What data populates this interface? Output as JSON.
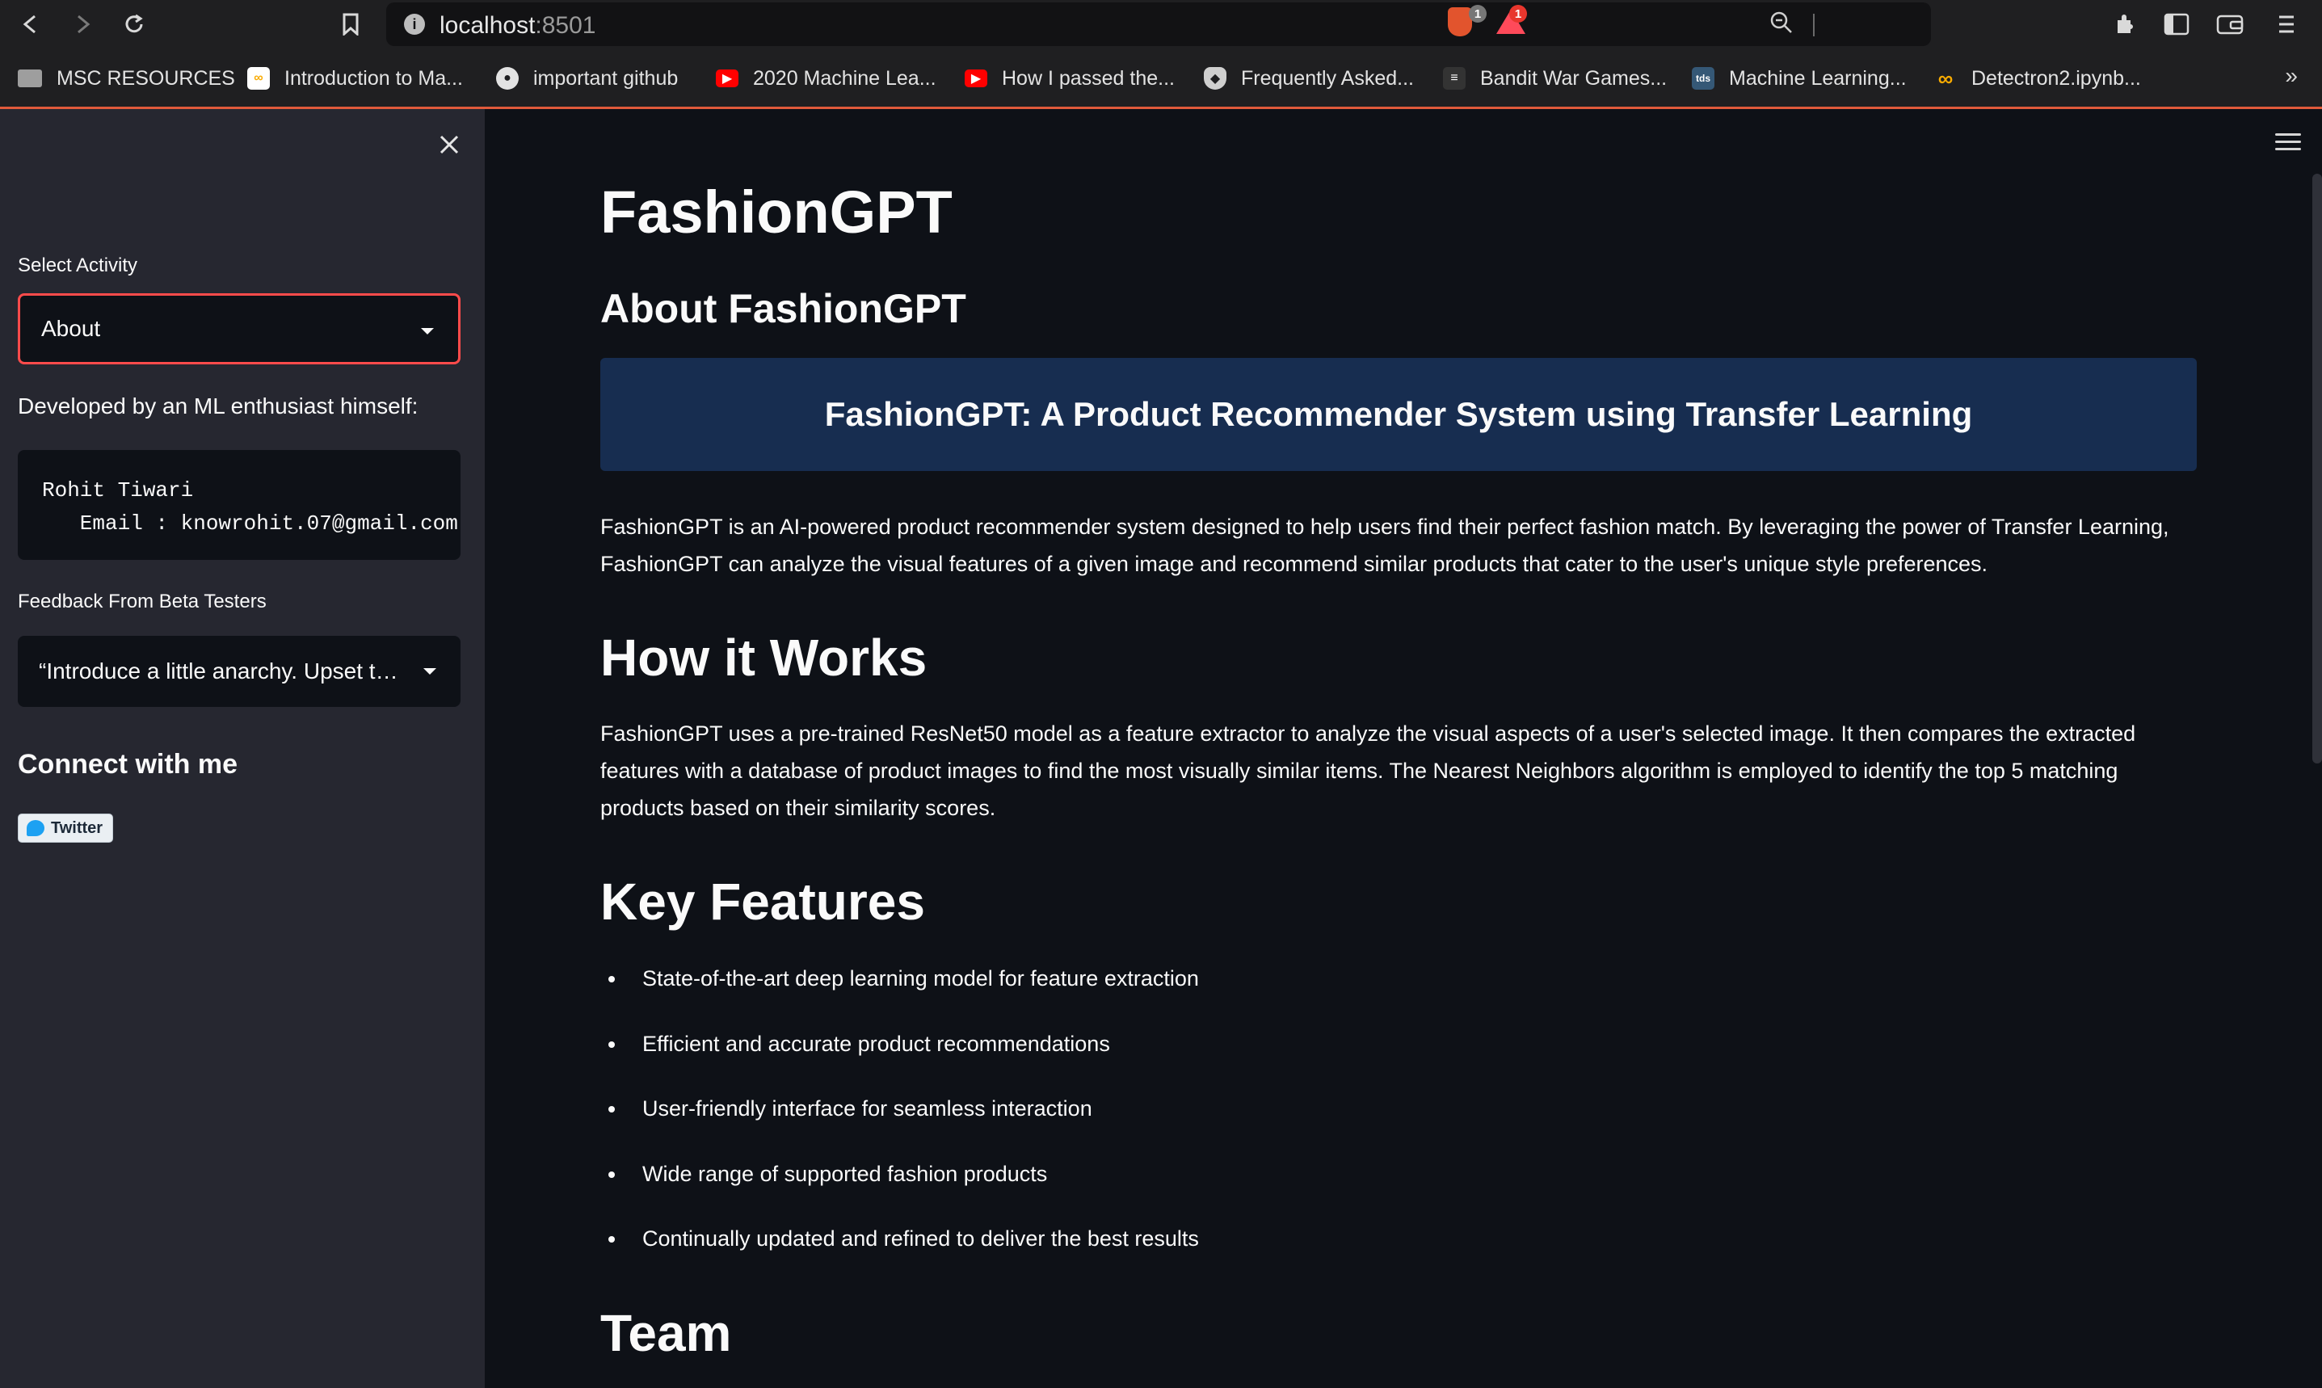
{
  "browser": {
    "url_host": "localhost",
    "url_port": ":8501",
    "shield_badge": "1",
    "rewards_badge": "1",
    "bookmarks": [
      {
        "label": "MSC RESOURCES",
        "icon": "folder-icon",
        "color": "#9e9e9e"
      },
      {
        "label": "Introduction to Ma...",
        "icon": "colab-icon",
        "color": "#ffffff"
      },
      {
        "label": "important github",
        "icon": "github-icon",
        "color": "#e3e3e3"
      },
      {
        "label": "2020 Machine Lea...",
        "icon": "youtube-icon",
        "color": "#ff0000"
      },
      {
        "label": "How I passed the...",
        "icon": "youtube-icon",
        "color": "#ff0000"
      },
      {
        "label": "Frequently Asked...",
        "icon": "shield-icon",
        "color": "#cfcfcf"
      },
      {
        "label": "Bandit War Games...",
        "icon": "overthewire-icon",
        "color": "#333333"
      },
      {
        "label": "Machine Learning...",
        "icon": "tds-icon",
        "color": "#355876"
      },
      {
        "label": "Detectron2.ipynb...",
        "icon": "colab-icon",
        "color": "#f9ab00"
      }
    ],
    "more": "»"
  },
  "sidebar": {
    "select_activity_label": "Select Activity",
    "select_activity_value": "About",
    "developer_label": "Developed by an ML enthusiast himself:",
    "developer_code": "Rohit Tiwari\n   Email : knowrohit.07@gmail.com",
    "feedback_label": "Feedback From Beta Testers",
    "feedback_value": "“Introduce a little anarchy. Upset the established order, and everything becomes chaos.”",
    "connect_title": "Connect with me",
    "twitter_label": "Twitter"
  },
  "main": {
    "title": "FashionGPT",
    "about_heading": "About FashionGPT",
    "banner": "FashionGPT: A Product Recommender System using Transfer Learning",
    "intro": "FashionGPT is an AI-powered product recommender system designed to help users find their perfect fashion match. By leveraging the power of Transfer Learning, FashionGPT can analyze the visual features of a given image and recommend similar products that cater to the user's unique style preferences.",
    "how_heading": "How it Works",
    "how_text": "FashionGPT uses a pre-trained ResNet50 model as a feature extractor to analyze the visual aspects of a user's selected image. It then compares the extracted features with a database of product images to find the most visually similar items. The Nearest Neighbors algorithm is employed to identify the top 5 matching products based on their similarity scores.",
    "key_heading": "Key Features",
    "features": [
      "State-of-the-art deep learning model for feature extraction",
      "Efficient and accurate product recommendations",
      "User-friendly interface for seamless interaction",
      "Wide range of supported fashion products",
      "Continually updated and refined to deliver the best results"
    ],
    "team_heading": "Team"
  },
  "colors": {
    "accent": "#ff4b4b",
    "sidebar_bg": "#262730",
    "main_bg": "#0e1117",
    "banner_bg": "#172d50"
  }
}
